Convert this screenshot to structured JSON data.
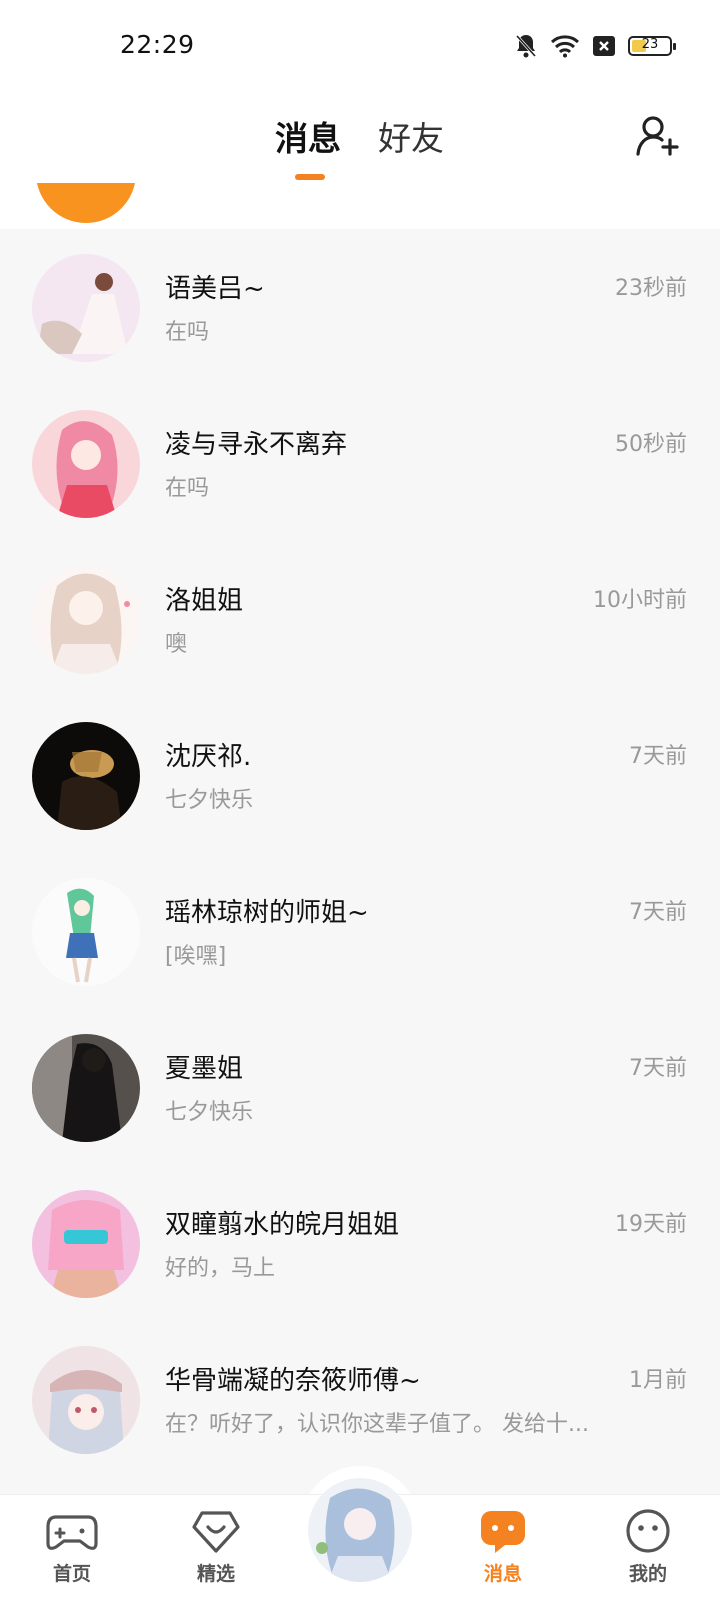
{
  "status_bar": {
    "time": "22:29",
    "battery_level": "23",
    "icons": [
      "mute-bell-icon",
      "wifi-icon",
      "sim-off-icon",
      "battery-icon"
    ]
  },
  "header": {
    "tabs": [
      {
        "label": "消息",
        "active": true
      },
      {
        "label": "好友",
        "active": false
      }
    ],
    "add_friend_icon": "add-person-icon",
    "accent_color": "#f58220"
  },
  "conversations": [
    {
      "name": "语美吕~",
      "time": "23秒前",
      "preview": "在吗"
    },
    {
      "name": "凌与寻永不离弃",
      "time": "50秒前",
      "preview": "在吗"
    },
    {
      "name": "洛姐姐",
      "time": "10小时前",
      "preview": "噢"
    },
    {
      "name": "沈厌祁.",
      "time": "7天前",
      "preview": "七夕快乐"
    },
    {
      "name": "瑶林琼树的师姐~",
      "time": "7天前",
      "preview": "[唉嘿]"
    },
    {
      "name": "夏墨姐",
      "time": "7天前",
      "preview": "七夕快乐"
    },
    {
      "name": "双瞳翦水的皖月姐姐",
      "time": "19天前",
      "preview": "好的，马上"
    },
    {
      "name": "华骨端凝的奈筱师傅~",
      "time": "1月前",
      "preview": "在？听好了，认识你这辈子值了。 发给十..."
    }
  ],
  "bottom_nav": [
    {
      "label": "首页",
      "icon": "gamepad-icon",
      "active": false
    },
    {
      "label": "精选",
      "icon": "heart-badge-icon",
      "active": false
    },
    {
      "label": "",
      "icon": "center-avatar",
      "active": false
    },
    {
      "label": "消息",
      "icon": "chat-bubble-icon",
      "active": true
    },
    {
      "label": "我的",
      "icon": "smiley-icon",
      "active": false
    }
  ]
}
